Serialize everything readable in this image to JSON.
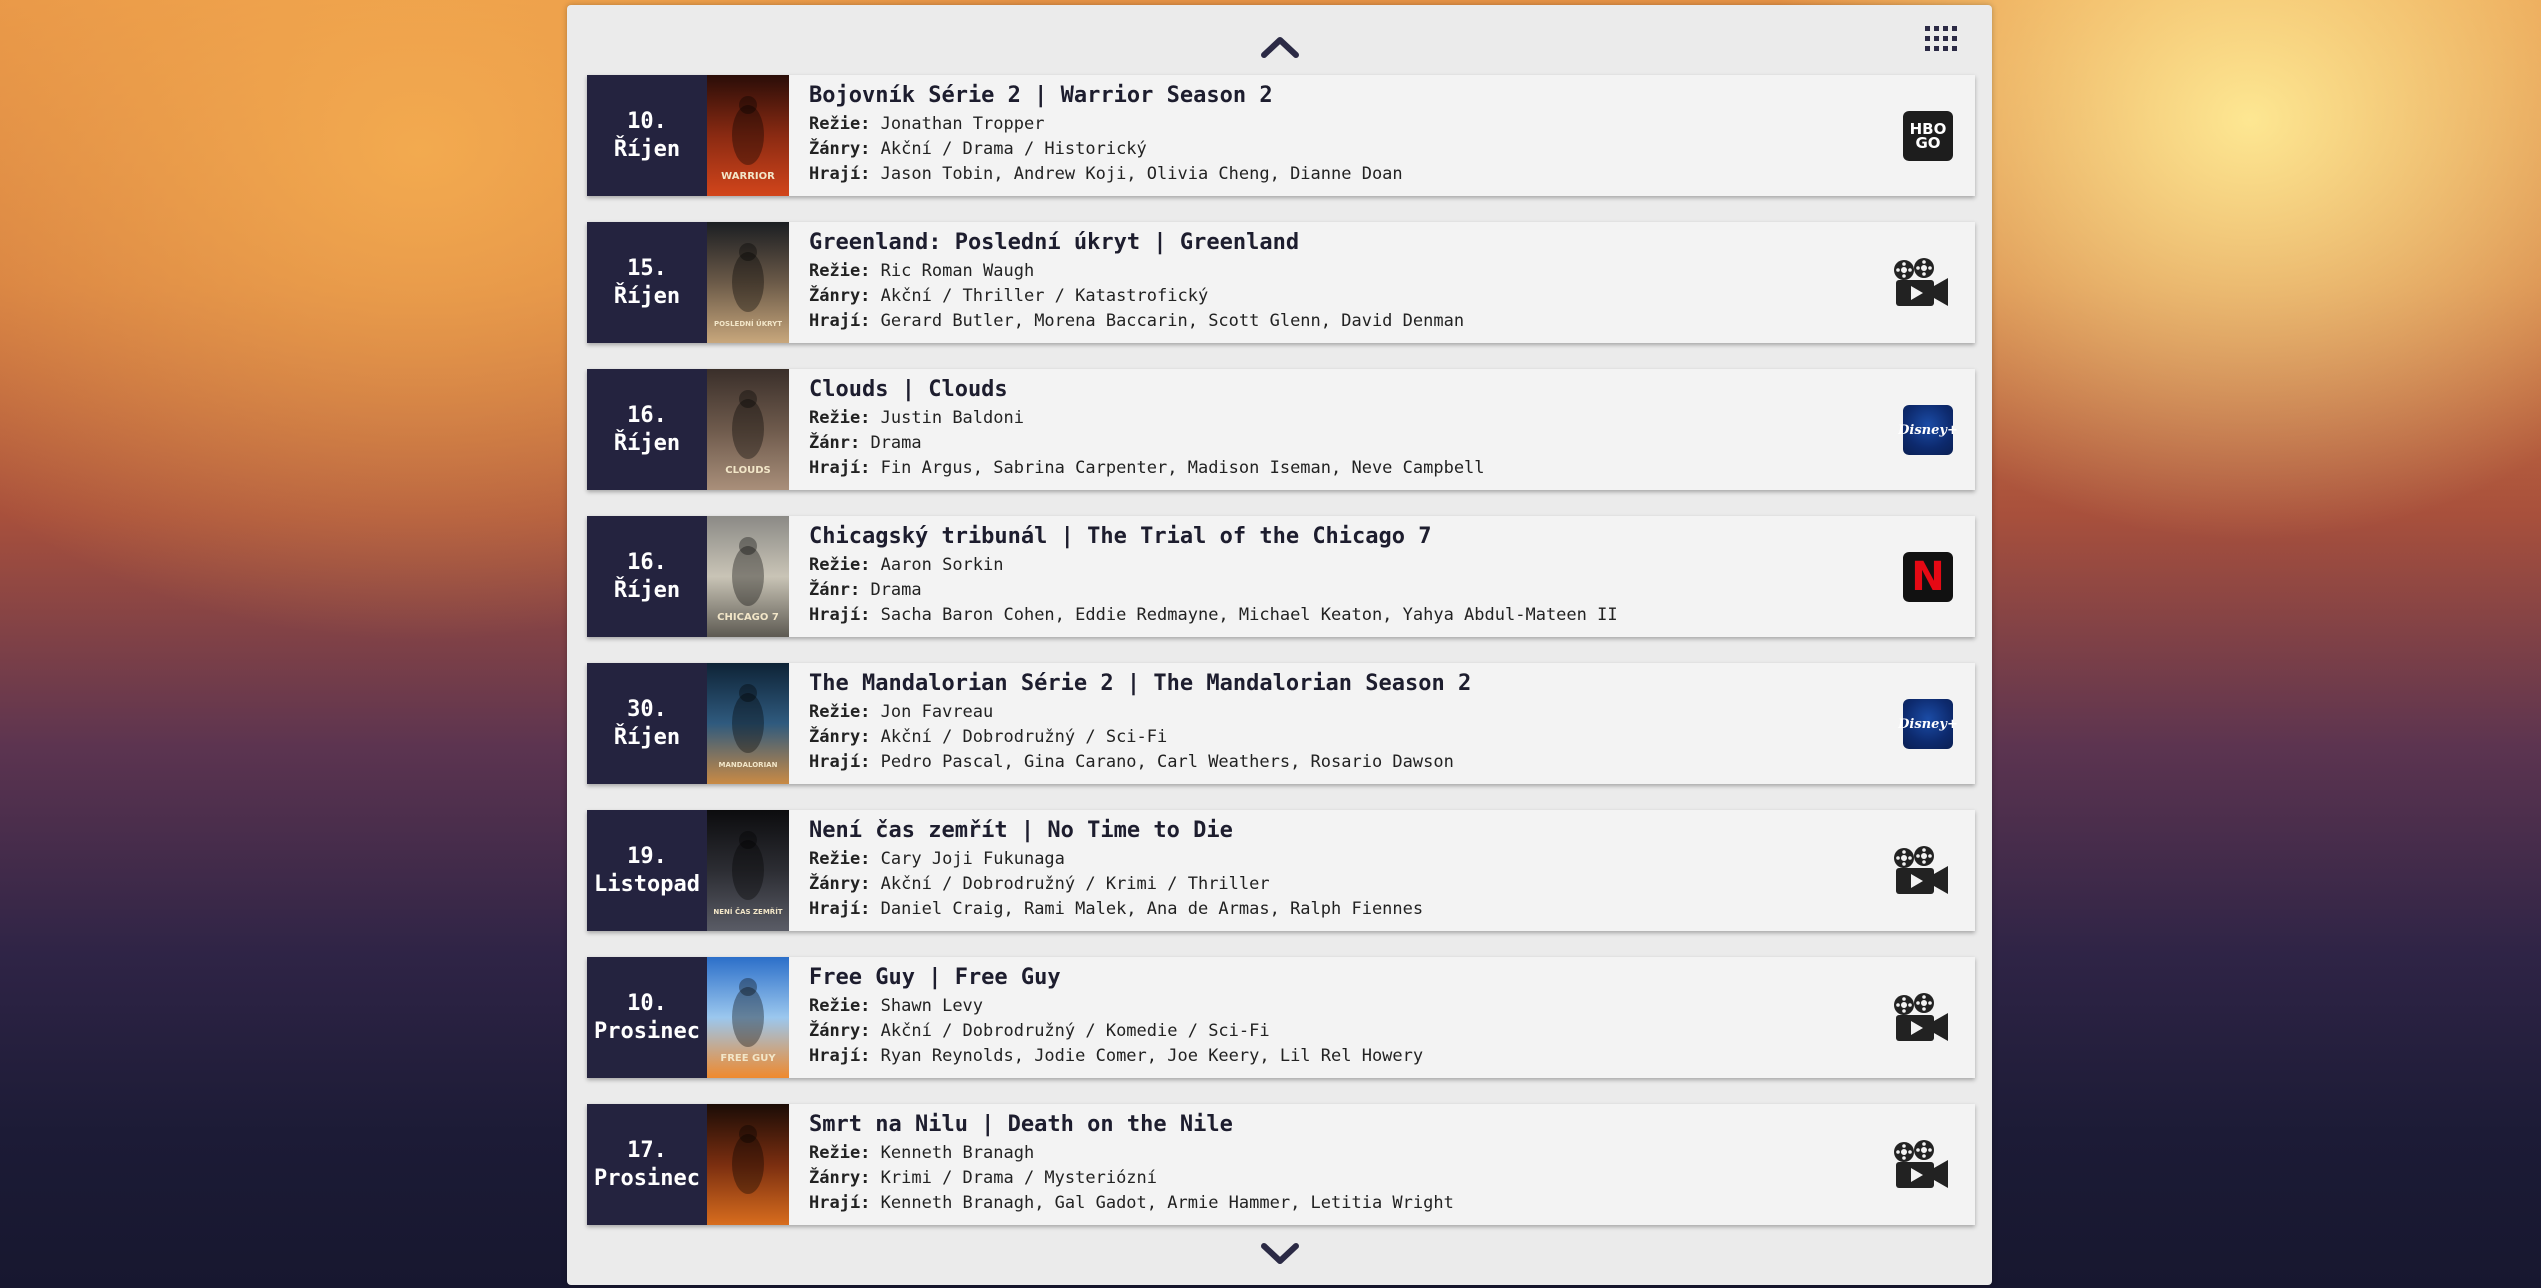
{
  "labels": {
    "director": "Režie:",
    "cast": "Hrají:"
  },
  "movies": [
    {
      "day": "10.",
      "month": "Říjen",
      "title": "Bojovník Série 2 | Warrior Season 2",
      "director": "Jonathan Tropper",
      "genre_label": "Žánry:",
      "genres": "Akční / Drama / Historický",
      "cast": "Jason Tobin, Andrew Koji, Olivia Cheng, Dianne Doan",
      "provider": "hbo-go",
      "provider_text_top": "HBO",
      "provider_text_bottom": "GO"
    },
    {
      "day": "15.",
      "month": "Říjen",
      "title": "Greenland: Poslední úkryt | Greenland",
      "director": "Ric Roman Waugh",
      "genre_label": "Žánry:",
      "genres": "Akční / Thriller / Katastrofický",
      "cast": "Gerard Butler, Morena Baccarin, Scott Glenn, David Denman",
      "provider": "cinema"
    },
    {
      "day": "16.",
      "month": "Říjen",
      "title": "Clouds | Clouds",
      "director": "Justin Baldoni",
      "genre_label": "Žánr:",
      "genres": "Drama",
      "cast": "Fin Argus, Sabrina Carpenter, Madison Iseman, Neve Campbell",
      "provider": "disney-plus",
      "provider_text": "Disney+"
    },
    {
      "day": "16.",
      "month": "Říjen",
      "title": "Chicagský tribunál | The Trial of the Chicago 7",
      "director": "Aaron Sorkin",
      "genre_label": "Žánr:",
      "genres": "Drama",
      "cast": "Sacha Baron Cohen, Eddie Redmayne, Michael Keaton, Yahya Abdul-Mateen II",
      "provider": "netflix",
      "provider_text": "N"
    },
    {
      "day": "30.",
      "month": "Říjen",
      "title": "The Mandalorian Série 2 | The Mandalorian Season 2",
      "director": "Jon Favreau",
      "genre_label": "Žánry:",
      "genres": "Akční / Dobrodružný / Sci-Fi",
      "cast": "Pedro Pascal, Gina Carano, Carl Weathers, Rosario Dawson",
      "provider": "disney-plus",
      "provider_text": "Disney+"
    },
    {
      "day": "19.",
      "month": "Listopad",
      "title": "Není čas zemřít | No Time to Die",
      "director": "Cary Joji Fukunaga",
      "genre_label": "Žánry:",
      "genres": "Akční / Dobrodružný / Krimi / Thriller",
      "cast": "Daniel Craig, Rami Malek, Ana de Armas, Ralph Fiennes",
      "provider": "cinema"
    },
    {
      "day": "10.",
      "month": "Prosinec",
      "title": "Free Guy | Free Guy",
      "director": "Shawn Levy",
      "genre_label": "Žánry:",
      "genres": "Akční / Dobrodružný / Komedie / Sci-Fi",
      "cast": "Ryan Reynolds, Jodie Comer, Joe Keery, Lil Rel Howery",
      "provider": "cinema"
    },
    {
      "day": "17.",
      "month": "Prosinec",
      "title": "Smrt na Nilu | Death on the Nile",
      "director": "Kenneth Branagh",
      "genre_label": "Žánry:",
      "genres": "Krimi / Drama / Mysteriózní",
      "cast": "Kenneth Branagh, Gal Gadot, Armie Hammer, Letitia Wright",
      "provider": "cinema"
    }
  ],
  "posters": [
    {
      "text": "WARRIOR",
      "colors": [
        "#2a0d08",
        "#8a2a12",
        "#d2451b"
      ]
    },
    {
      "text": "POSLEDNÍ ÚKRYT",
      "colors": [
        "#1b1e22",
        "#6b5a48",
        "#c8a77c"
      ]
    },
    {
      "text": "CLOUDS",
      "colors": [
        "#3a2f2a",
        "#6e5a4c",
        "#a98f7a"
      ]
    },
    {
      "text": "CHICAGO 7",
      "colors": [
        "#8b8a86",
        "#c9c4b6",
        "#5d5a52"
      ]
    },
    {
      "text": "MANDALORIAN",
      "colors": [
        "#0e2336",
        "#2f5a7e",
        "#c98a45"
      ]
    },
    {
      "text": "NENÍ ČAS ZEMŘÍT",
      "colors": [
        "#0c0c0e",
        "#2c2d33",
        "#5a5c66"
      ]
    },
    {
      "text": "FREE GUY",
      "colors": [
        "#2c6fc9",
        "#9bc7ee",
        "#ef8a2e"
      ]
    },
    {
      "text": "",
      "colors": [
        "#1b0c06",
        "#7a2e10",
        "#d86d1e"
      ]
    }
  ],
  "icons": {
    "nav_up": "chevron-up-icon",
    "nav_down": "chevron-down-icon",
    "menu": "grid-icon",
    "cinema": "movie-camera-icon"
  },
  "colors": {
    "date_bg": "#24233f",
    "card_bg": "#f3f3f3",
    "panel_bg": "#ebebeb",
    "accent": "#2b2a45"
  }
}
